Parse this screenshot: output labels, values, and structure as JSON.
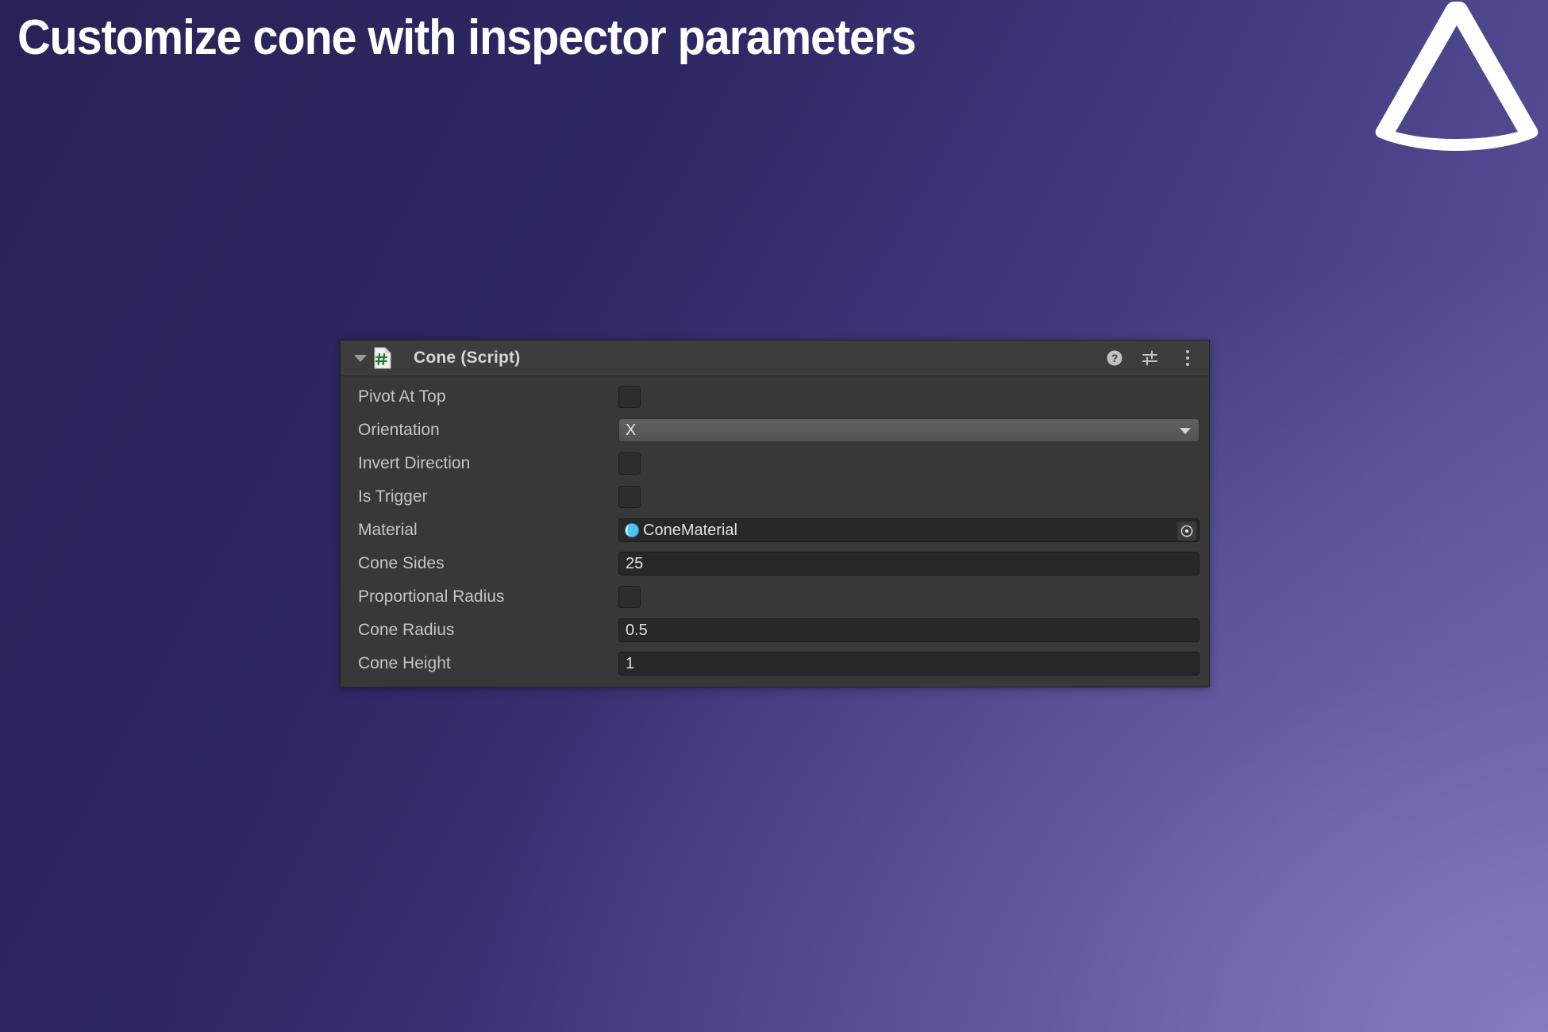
{
  "slide": {
    "title": "Customize cone with inspector parameters",
    "logo_icon": "cone-outline-icon",
    "background_color_start": "#282356",
    "background_color_end": "#6f67ab",
    "title_color": "#ffffff"
  },
  "inspector": {
    "header": {
      "foldout_icon": "triangle-down-icon",
      "script_icon": "csharp-script-icon",
      "title": "Cone (Script)",
      "help_icon": "help-question-icon",
      "preset_icon": "preset-sliders-icon",
      "menu_icon": "kebab-menu-icon"
    },
    "panel_color": "#383838",
    "header_color": "#3d3d3d",
    "properties": [
      {
        "label": "Pivot At Top",
        "type": "checkbox",
        "value": false
      },
      {
        "label": "Orientation",
        "type": "dropdown",
        "value": "X"
      },
      {
        "label": "Invert Direction",
        "type": "checkbox",
        "value": false
      },
      {
        "label": "Is Trigger",
        "type": "checkbox",
        "value": false
      },
      {
        "label": "Material",
        "type": "object",
        "value": "ConeMaterial",
        "icon": "material-sphere-icon",
        "picker_icon": "object-picker-icon"
      },
      {
        "label": "Cone Sides",
        "type": "number",
        "value": "25"
      },
      {
        "label": "Proportional Radius",
        "type": "checkbox",
        "value": false
      },
      {
        "label": "Cone Radius",
        "type": "number",
        "value": "0.5"
      },
      {
        "label": "Cone Height",
        "type": "number",
        "value": "1"
      }
    ]
  }
}
